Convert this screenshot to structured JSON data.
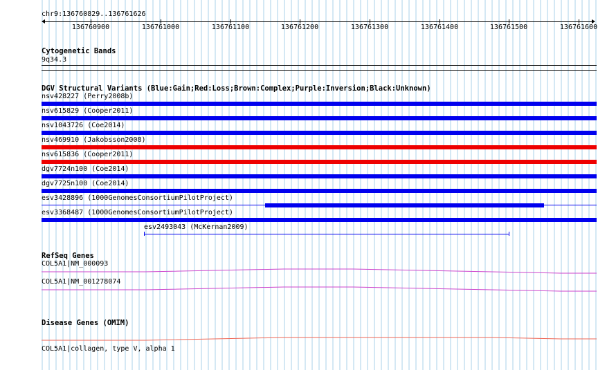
{
  "colors": {
    "grid": "#a8d0e8",
    "gain": "#0000ee",
    "loss": "#ee0000",
    "refseq_gene": "#cc44cc",
    "omim_gene": "#ee6655",
    "axis": "#000000"
  },
  "ruler": {
    "range_label": "chr9:136760829..136761626",
    "ticks": [
      "136760900",
      "136761000",
      "136761100",
      "136761200",
      "136761300",
      "136761400",
      "136761500",
      "136761600"
    ]
  },
  "cytoband": {
    "title": "Cytogenetic Bands",
    "band": "9q34.3"
  },
  "dgv": {
    "title": "DGV Structural Variants (Blue:Gain;Red:Loss;Brown:Complex;Purple:Inversion;Black:Unknown)",
    "variants": [
      {
        "label": "nsv428227 (Perry2008b)",
        "type": "gain",
        "style": "full"
      },
      {
        "label": "nsv615829 (Cooper2011)",
        "type": "gain",
        "style": "full"
      },
      {
        "label": "nsv1043726 (Coe2014)",
        "type": "gain",
        "style": "full"
      },
      {
        "label": "nsv469910 (Jakobsson2008)",
        "type": "loss",
        "style": "full"
      },
      {
        "label": "nsv615836 (Cooper2011)",
        "type": "loss",
        "style": "full"
      },
      {
        "label": "dgv7724n100 (Coe2014)",
        "type": "gain",
        "style": "full"
      },
      {
        "label": "dgv7725n100 (Coe2014)",
        "type": "gain",
        "style": "full"
      },
      {
        "label": "esv3428896 (1000GenomesConsortiumPilotProject)",
        "type": "gain",
        "style": "partial"
      },
      {
        "label": "esv3368487 (1000GenomesConsortiumPilotProject)",
        "type": "gain",
        "style": "full"
      },
      {
        "label": "esv2493043 (McKernan2009)",
        "type": "gain",
        "style": "interval"
      }
    ]
  },
  "refseq": {
    "title": "RefSeq Genes",
    "genes": [
      "COL5A1|NM_000093",
      "COL5A1|NM_001278074"
    ]
  },
  "omim": {
    "title": "Disease Genes (OMIM)",
    "genes": [
      "COL5A1|collagen, type V, alpha 1"
    ]
  }
}
